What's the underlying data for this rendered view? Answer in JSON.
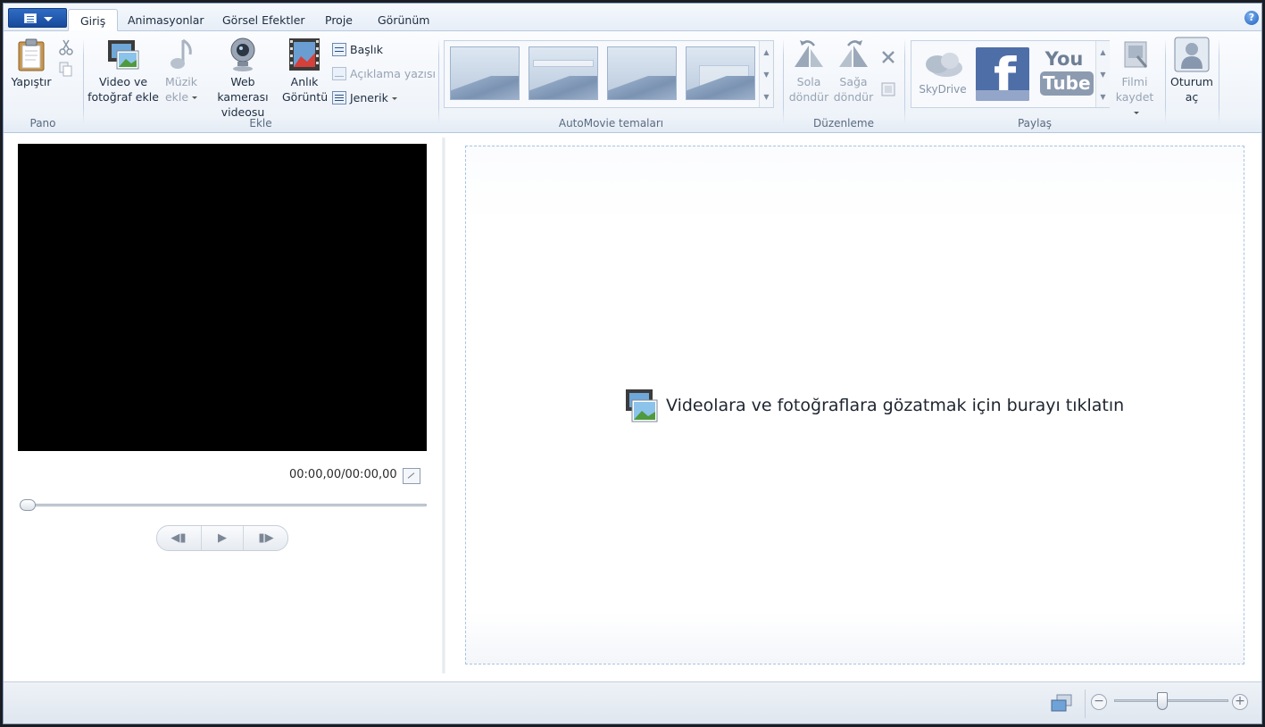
{
  "tabs": [
    {
      "label": "Giriş",
      "active": true
    },
    {
      "label": "Animasyonlar"
    },
    {
      "label": "Görsel Efektler"
    },
    {
      "label": "Proje"
    },
    {
      "label": "Görünüm"
    }
  ],
  "ribbon": {
    "pano": {
      "label": "Pano",
      "paste": "Yapıştır"
    },
    "ekle": {
      "label": "Ekle",
      "add_video": [
        "Video ve",
        "fotoğraf ekle"
      ],
      "add_music": [
        "Müzik",
        "ekle"
      ],
      "webcam": [
        "Web kamerası",
        "videosu"
      ],
      "snapshot": [
        "Anlık",
        "Görüntü"
      ],
      "title": "Başlık",
      "caption": "Açıklama yazısı",
      "credits": "Jenerik"
    },
    "automovie": {
      "label": "AutoMovie temaları"
    },
    "duzenleme": {
      "label": "Düzenleme",
      "rotate_left": [
        "Sola",
        "döndür"
      ],
      "rotate_right": [
        "Sağa",
        "döndür"
      ]
    },
    "paylas": {
      "label": "Paylaş",
      "skydrive": "SkyDrive",
      "youtube_top": "You",
      "youtube_bottom": "Tube",
      "save_movie": [
        "Filmi",
        "kaydet"
      ]
    },
    "signin": [
      "Oturum",
      "aç"
    ]
  },
  "preview": {
    "time": "00:00,00/00:00,00"
  },
  "storyboard": {
    "browse_text": "Videolara ve fotoğraflara gözatmak için burayı tıklatın"
  },
  "status": {
    "zoom_minus": "−",
    "zoom_plus": "+"
  },
  "colors": {
    "accent": "#1e5fbf",
    "facebook": "#4e6ea8"
  }
}
